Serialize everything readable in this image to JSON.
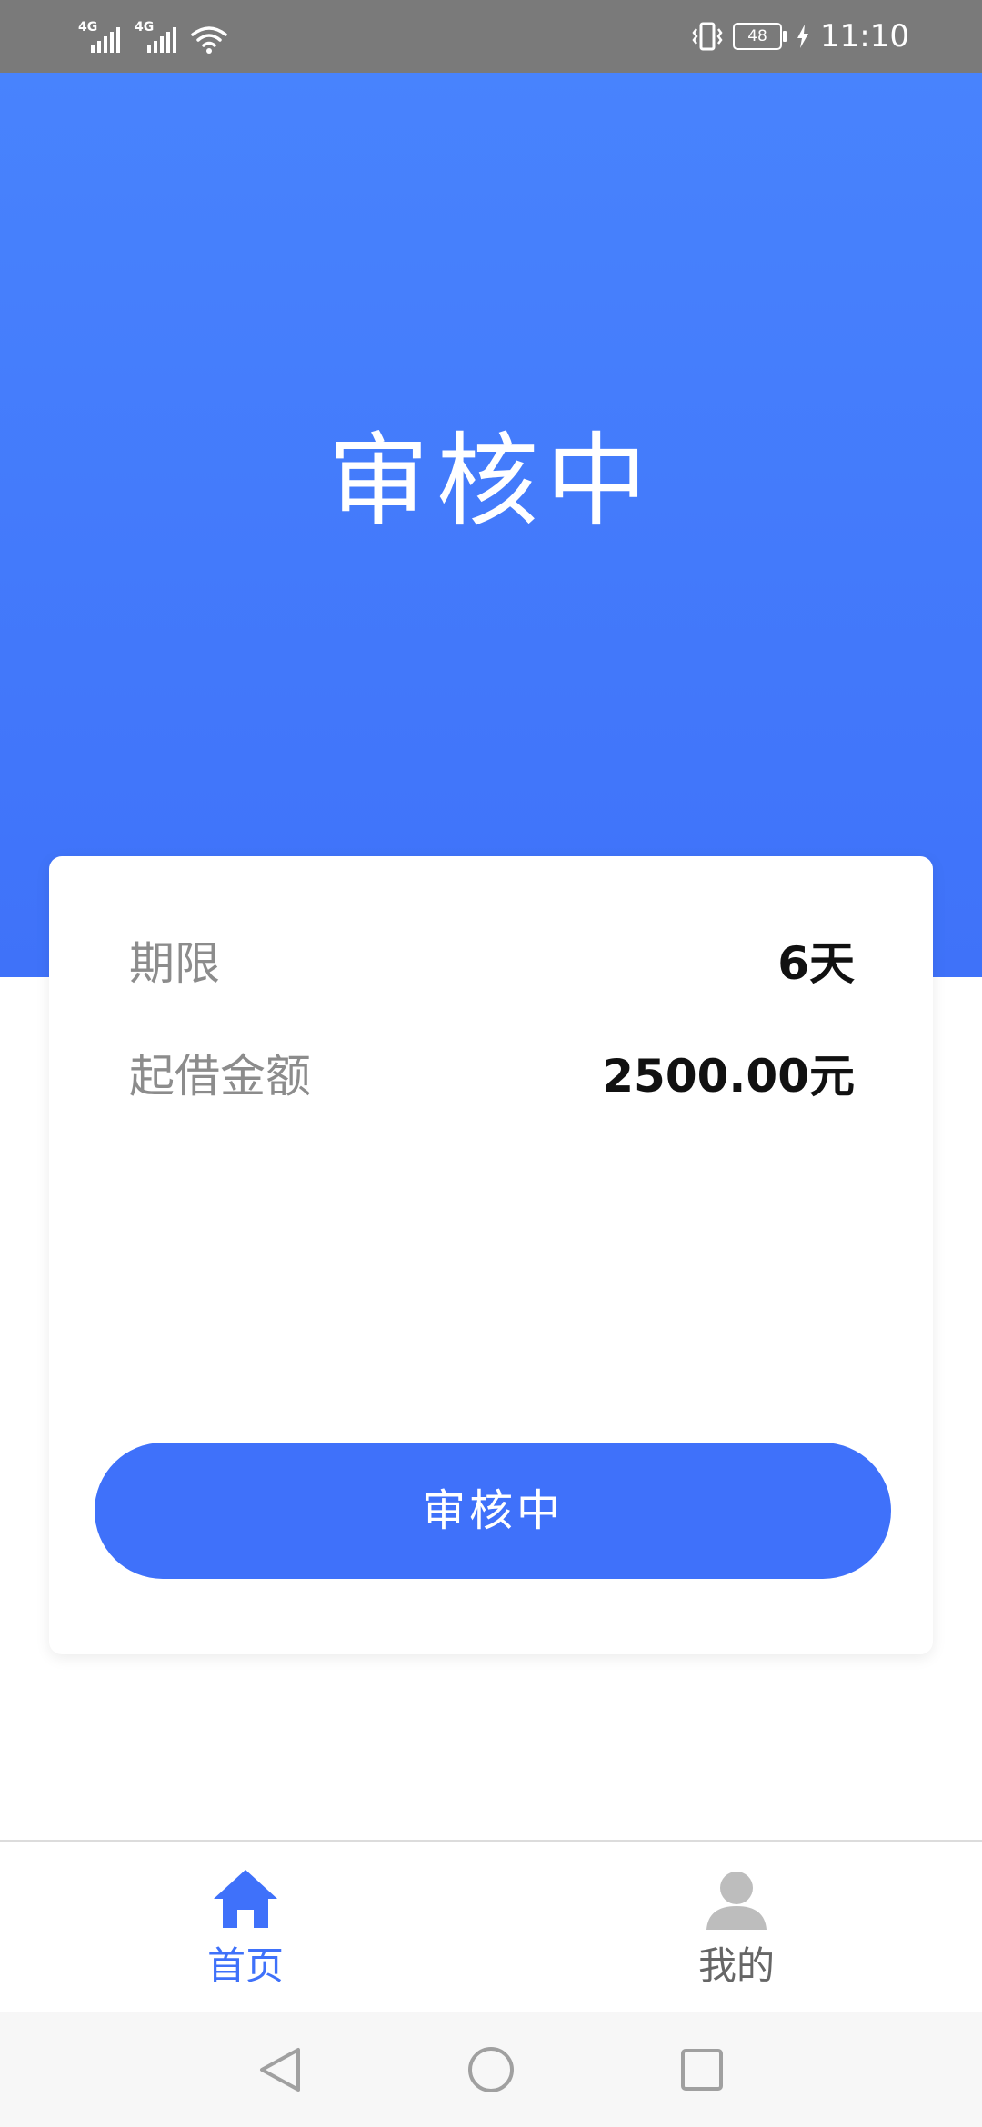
{
  "status_bar": {
    "network_1": "4G",
    "network_2": "4G",
    "battery_level": "48",
    "time": "11:10",
    "icons": [
      "signal-icon",
      "signal-icon",
      "wifi-icon",
      "vibrate-icon",
      "battery-icon",
      "charging-icon"
    ]
  },
  "header": {
    "title": "审核中"
  },
  "loan": {
    "term_label": "期限",
    "term_value": "6天",
    "amount_label": "起借金额",
    "amount_value": "2500.00元"
  },
  "status_button": {
    "label": "审核中"
  },
  "tab_bar": {
    "tabs": [
      {
        "label": "首页",
        "icon": "home-icon",
        "active": true
      },
      {
        "label": "我的",
        "icon": "user-icon",
        "active": false
      }
    ]
  },
  "system_nav": {
    "buttons": [
      "back-icon",
      "home-circle-icon",
      "recent-apps-icon"
    ]
  },
  "colors": {
    "primary": "#3f71fa",
    "header_top": "#4883fd",
    "status_bar": "#7a7a7a",
    "label_gray": "#8c8c8c",
    "tab_inactive": "#666666"
  }
}
